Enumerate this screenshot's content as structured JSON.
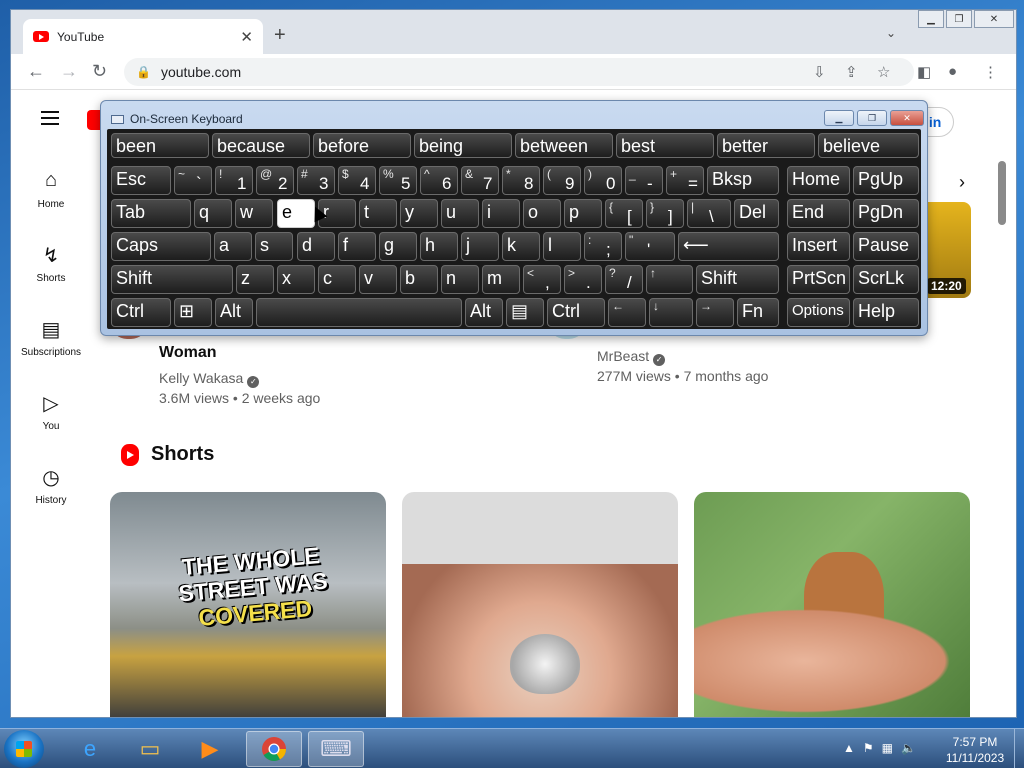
{
  "browser": {
    "tab_title": "YouTube",
    "tab_close": "✕",
    "new_tab": "+",
    "url": "youtube.com"
  },
  "youtube": {
    "signin": "ign in",
    "guide": [
      {
        "label": "Home",
        "icon": "home-icon"
      },
      {
        "label": "Shorts",
        "icon": "shorts-icon"
      },
      {
        "label": "Subscriptions",
        "icon": "subscriptions-icon"
      },
      {
        "label": "You",
        "icon": "you-icon"
      },
      {
        "label": "History",
        "icon": "history-icon"
      }
    ],
    "videos": [
      {
        "title": "Woman",
        "channel": "Kelly Wakasa",
        "stats": "3.6M views • 2 weeks ago"
      },
      {
        "channel": "MrBeast",
        "stats": "277M views • 7 months ago"
      }
    ],
    "duration": "12:20",
    "shorts_heading": "Shorts",
    "short1_text": [
      "THE WHOLE",
      "STREET WAS",
      "COVERED"
    ]
  },
  "osk": {
    "title": "On-Screen Keyboard",
    "suggestions": [
      "been",
      "because",
      "before",
      "being",
      "between",
      "best",
      "better",
      "believe"
    ],
    "rows": {
      "r1": [
        "Esc",
        "Bksp"
      ],
      "nav": [
        "Home",
        "PgUp",
        "End",
        "PgDn",
        "Insert",
        "Pause",
        "PrtScn",
        "ScrLk",
        "Options",
        "Help"
      ],
      "r2": [
        "Tab",
        "q",
        "w",
        "e",
        "r",
        "t",
        "y",
        "u",
        "i",
        "o",
        "p",
        "Del"
      ],
      "r3": [
        "Caps",
        "a",
        "s",
        "d",
        "f",
        "g",
        "h",
        "j",
        "k",
        "l"
      ],
      "r4": [
        "Shift",
        "z",
        "x",
        "c",
        "v",
        "b",
        "n",
        "m",
        "Shift"
      ],
      "r5": [
        "Ctrl",
        "Alt",
        "Alt",
        "Ctrl",
        "Fn"
      ]
    }
  },
  "taskbar": {
    "time": "7:57 PM",
    "date": "11/11/2023"
  },
  "colors": {
    "youtube_red": "#ff0000",
    "link_blue": "#065fd4",
    "osk_key": "#1d1d1d",
    "osk_highlight": "#ffffff"
  }
}
